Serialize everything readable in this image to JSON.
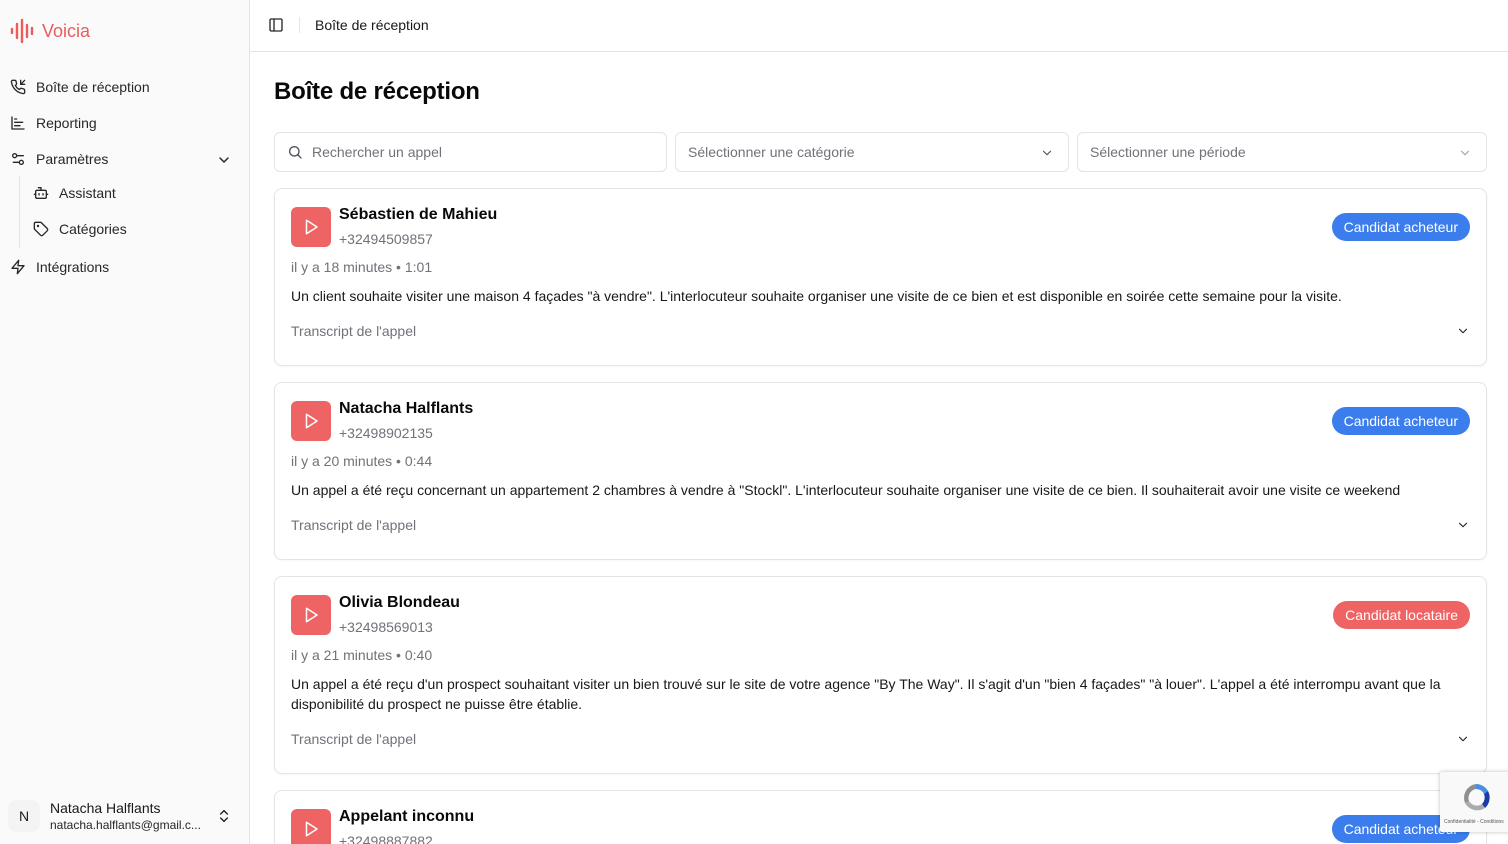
{
  "app": {
    "name": "Voicia",
    "brand_color": "#e85d5d"
  },
  "sidebar": {
    "items": [
      {
        "label": "Boîte de réception",
        "icon": "phone-incoming-icon"
      },
      {
        "label": "Reporting",
        "icon": "bar-chart-icon"
      },
      {
        "label": "Paramètres",
        "icon": "settings-sliders-icon"
      },
      {
        "label": "Intégrations",
        "icon": "lightning-icon"
      }
    ],
    "sub_items": [
      {
        "label": "Assistant",
        "icon": "bot-icon"
      },
      {
        "label": "Catégories",
        "icon": "tag-icon"
      }
    ],
    "user": {
      "initial": "N",
      "name": "Natacha Halflants",
      "email": "natacha.halflants@gmail.c..."
    }
  },
  "header": {
    "title": "Boîte de réception"
  },
  "main": {
    "title": "Boîte de réception",
    "search_placeholder": "Rechercher un appel",
    "category_placeholder": "Sélectionner une catégorie",
    "period_placeholder": "Sélectionner une période",
    "calls": [
      {
        "name": "Sébastien de Mahieu",
        "phone": "+32494509857",
        "time": "il y a 18 minutes",
        "duration": "1:01",
        "summary": "Un client souhaite visiter une maison 4 façades \"à vendre\". L'interlocuteur souhaite organiser une visite de ce bien et est disponible en soirée cette semaine pour la visite.",
        "transcript_label": "Transcript de l'appel",
        "category": "Candidat acheteur",
        "category_color": "#3b7ded"
      },
      {
        "name": "Natacha Halflants",
        "phone": "+32498902135",
        "time": "il y a 20 minutes",
        "duration": "0:44",
        "summary": "Un appel a été reçu concernant un appartement 2 chambres à vendre à \"Stockl\". L'interlocuteur souhaite organiser une visite de ce bien. Il souhaiterait avoir une visite ce weekend",
        "transcript_label": "Transcript de l'appel",
        "category": "Candidat acheteur",
        "category_color": "#3b7ded"
      },
      {
        "name": "Olivia Blondeau",
        "phone": "+32498569013",
        "time": "il y a 21 minutes",
        "duration": "0:40",
        "summary": "Un appel a été reçu d'un prospect souhaitant visiter un bien trouvé sur le site de votre agence \"By The Way\". Il s'agit d'un \"bien 4 façades\" \"à louer\". L'appel a été interrompu avant que la disponibilité du prospect ne puisse être établie.",
        "transcript_label": "Transcript de l'appel",
        "category": "Candidat locataire",
        "category_color": "#ee6363"
      },
      {
        "name": "Appelant inconnu",
        "phone": "+32498887882",
        "category": "Candidat acheteur",
        "category_color": "#3b7ded"
      }
    ]
  },
  "recaptcha": {
    "text": "Confidentialité - Conditions"
  }
}
